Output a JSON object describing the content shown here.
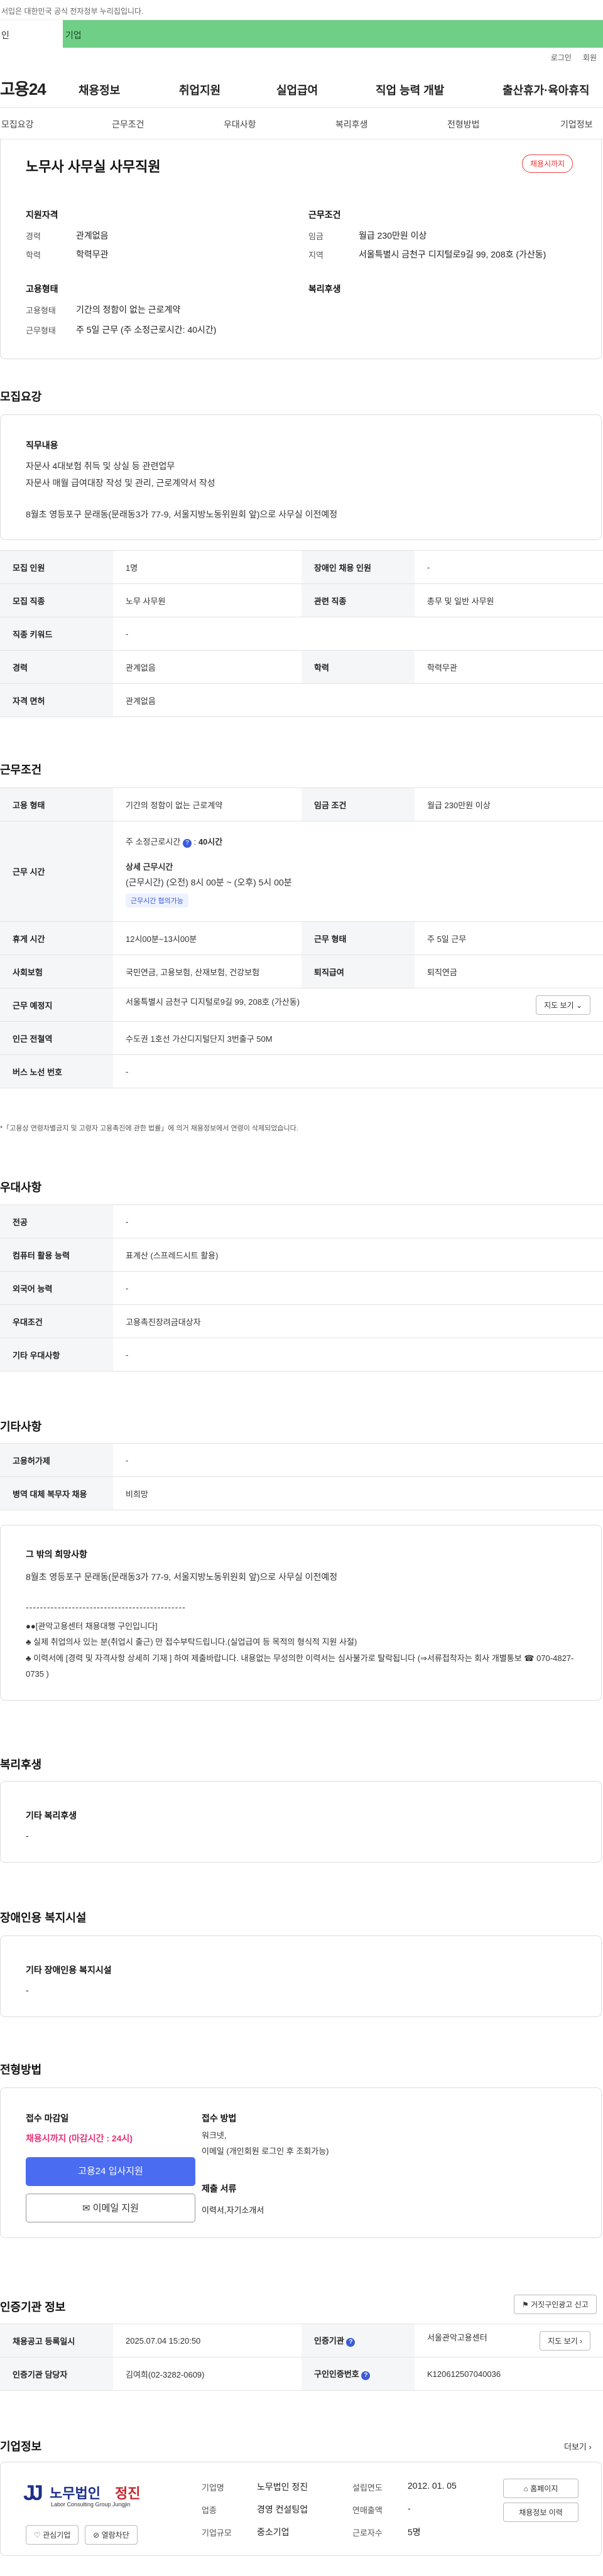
{
  "top_notice": "서입은 대한민국 공식 전자정부 누리집입니다.",
  "tabs": {
    "person": "인",
    "company": "기업"
  },
  "util": {
    "login": "로그인",
    "join": "회원"
  },
  "logo": "고용24",
  "gnb": [
    "채용정보",
    "취업지원",
    "실업급여",
    "직업 능력 개발",
    "출산휴가·육아휴직"
  ],
  "subnav": [
    "모집요강",
    "근무조건",
    "우대사항",
    "복리후생",
    "전형방법",
    "기업정보"
  ],
  "job": {
    "title": "노무사 사무실 사무직원",
    "status_badge": "채용시까지",
    "qual_heading": "지원자격",
    "career_label": "경력",
    "career": "관계없음",
    "edu_label": "학력",
    "edu": "학력무관",
    "cond_heading": "근무조건",
    "wage_label": "임금",
    "wage": "월급 230만원 이상",
    "loc_label": "지역",
    "loc": "서울특별시 금천구 디지털로9길 99, 208호 (가산동)",
    "emp_heading": "고용형태",
    "emptype_label": "고용형태",
    "emptype": "기간의 정함이 없는 근로계약",
    "worktype_label": "근무형태",
    "worktype": "주 5일 근무 (주 소정근로시간: 40시간)",
    "welfare_heading": "복리후생"
  },
  "recruit": {
    "heading": "모집요강",
    "duty_label": "직무내용",
    "duty_text": "자문사 4대보험 취득 및 상실 등 관련업무\n자문사 매월 급여대장 작성 및 관리, 근로계약서 작성",
    "duty_extra": "8월초 영등포구 문래동(문래동3가 77-9, 서울지방노동위원회 앞)으로 사무실 이전예정",
    "rows": [
      {
        "l1": "모집 인원",
        "v1": "1명",
        "l2": "장애인 채용 인원",
        "v2": "-"
      },
      {
        "l1": "모집 직종",
        "v1": "노무 사무원",
        "l2": "관련 직종",
        "v2": "총무 및 일반 사무원"
      },
      {
        "l1": "직종 키워드",
        "v1": "-"
      },
      {
        "l1": "경력",
        "v1": "관계없음",
        "l2": "학력",
        "v2": "학력무관"
      },
      {
        "l1": "자격 면허",
        "v1": "관계없음"
      }
    ]
  },
  "work": {
    "heading": "근무조건",
    "emp_l": "고용 형태",
    "emp_v": "기간의 정함이 없는 근로계약",
    "wage_l": "임금 조건",
    "wage_v": "월급 230만원 이상",
    "hours_l": "근무 시간",
    "hours_main": "주 소정근로시간",
    "hours_main_v": "40시간",
    "hours_detail_l": "상세 근무시간",
    "hours_detail_v": "(근무시간) (오전) 8시 00분 ~ (오후) 5시 00분",
    "hours_flex": "근무시간 협의가능",
    "break_l": "휴게 시간",
    "break_v": "12시00분~13시00분",
    "shape_l": "근무 형태",
    "shape_v": "주 5일 근무",
    "ins_l": "사회보험",
    "ins_v": "국민연금, 고용보험, 산재보험, 건강보험",
    "sev_l": "퇴직급여",
    "sev_v": "퇴직연금",
    "place_l": "근무 예정지",
    "place_v": "서울특별시 금천구 디지털로9길 99, 208호 (가산동)",
    "map_btn": "지도 보기",
    "sub_l": "인근 전철역",
    "sub_v": "수도권 1호선 가산디지털단지 3번출구 50M",
    "bus_l": "버스 노선 번호",
    "bus_v": "-",
    "note": "*「고용상 연령차별금지 및 고령자 고용촉진에 관한 법률」에 의거 채용정보에서 연령이 삭제되었습니다."
  },
  "prefer": {
    "heading": "우대사항",
    "rows": [
      {
        "l": "전공",
        "v": "-"
      },
      {
        "l": "컴퓨터 활용 능력",
        "v": "표계산 (스프레드시트 활용)"
      },
      {
        "l": "외국어 능력",
        "v": "-"
      },
      {
        "l": "우대조건",
        "v": "고용촉진장려금대상자"
      },
      {
        "l": "기타 우대사항",
        "v": "-"
      }
    ]
  },
  "etc": {
    "heading": "기타사항",
    "rows": [
      {
        "l": "고용허가제",
        "v": "-"
      },
      {
        "l": "병역 대체 복무자 채용",
        "v": "비희망"
      }
    ],
    "other_label": "그 밖의 희망사항",
    "other_text": "8월초 영등포구 문래동(문래동3가 77-9, 서울지방노동위원회 앞)으로 사무실 이전예정",
    "dashes": "---------------------------------------------",
    "lines": "●●[관악고용센터 채용대행 구인입니다]\n♣ 실제 취업의사 있는 분(취업시 출근) 만 접수부탁드립니다.(실업급여 등 목적의 형식적 지원 사절)\n♣ 이력서에 [경력 및 자격사항 상세히 기재 ] 하여 제출바랍니다. 내용없는 무성의한 이력서는 심사불가로 탈락됩니다 (⇒서류접착자는 회사 개별통보 ☎ 070-4827-0735 )"
  },
  "welfare": {
    "heading": "복리후생",
    "label": "기타 복리후생",
    "value": "-"
  },
  "disability": {
    "heading": "장애인용 복지시설",
    "label": "기타 장애인용 복지시설",
    "value": "-"
  },
  "apply": {
    "heading": "전형방법",
    "deadline_l": "접수 마감일",
    "deadline_v": "채용시까지 (마감시간 : 24시)",
    "btn_apply": "고용24 입사지원",
    "btn_email": "이메일 지원",
    "method_l": "접수 방법",
    "method_v": "워크넷,\n이메일 (개인회원 로그인 후 조회가능)",
    "docs_l": "제출 서류",
    "docs_v": "이력서,자기소개서"
  },
  "agency": {
    "heading": "인증기관 정보",
    "report_btn": "거짓구인광고 신고",
    "reg_l": "채용공고 등록일시",
    "reg_v": "2025.07.04 15:20:50",
    "org_l": "인증기관",
    "org_v": "서울관악고용센터",
    "map_btn": "지도 보기",
    "mgr_l": "인증기관 담당자",
    "mgr_v": "김여희(02-3282-0609)",
    "id_l": "구인인증번호",
    "id_v": "K120612507040036"
  },
  "company": {
    "heading": "기업정보",
    "more": "더보기",
    "logo_big": "노무법인",
    "logo_name": "정진",
    "logo_sub": "Labor Consulting Group Jungjin",
    "name_l": "기업명",
    "name_v": "노무법인 정진",
    "ind_l": "업종",
    "ind_v": "경영 컨설팅업",
    "size_l": "기업규모",
    "size_v": "중소기업",
    "est_l": "설립연도",
    "est_v": "2012. 01. 05",
    "rev_l": "연매출액",
    "rev_v": "-",
    "emp_l": "근로자수",
    "emp_v": "5명",
    "homepage_btn": "홈페이지",
    "history_btn": "채용정보 이력",
    "fav_btn": "관심기업",
    "block_btn": "열람차단"
  }
}
